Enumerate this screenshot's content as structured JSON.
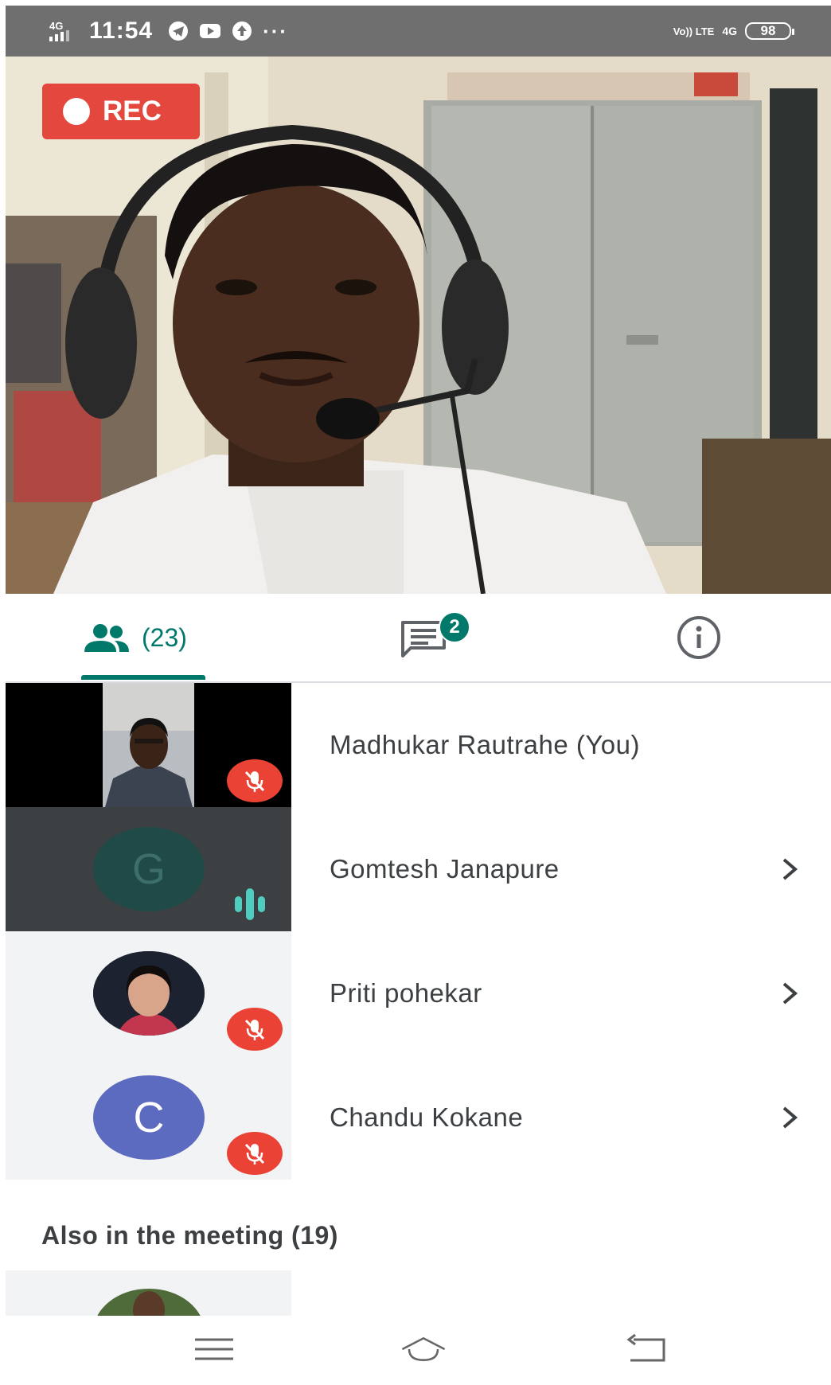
{
  "status_bar": {
    "network_type": "4G",
    "time": "11:54",
    "more": "···",
    "volte": "Vo)) LTE",
    "network_right": "4G",
    "battery": "98"
  },
  "recording": {
    "label": "REC"
  },
  "tabs": {
    "people_count": "(23)",
    "chat_badge": "2"
  },
  "participants": [
    {
      "name": "Madhukar Rautrahe (You)",
      "muted": true
    },
    {
      "name": "Gomtesh Janapure",
      "avatar_letter": "G",
      "speaking": true
    },
    {
      "name": "Priti pohekar",
      "muted": true
    },
    {
      "name": "Chandu Kokane",
      "avatar_letter": "C",
      "muted": true
    }
  ],
  "also_in_meeting": {
    "label": "Also in the meeting (19)"
  },
  "colors": {
    "accent": "#00796b",
    "mute_red": "#ea4335",
    "rec_red": "#e3473d",
    "avatar_c": "#5c6bc0",
    "avatar_g": "#1f4a48"
  },
  "icons": {
    "people_tab": "people-icon",
    "chat_tab": "chat-icon",
    "info_tab": "info-icon",
    "row_action": "chevron-right-icon",
    "mute": "mic-off-icon",
    "speaking": "audio-level-icon",
    "nav": [
      "menu-icon",
      "home-icon",
      "back-icon"
    ]
  }
}
